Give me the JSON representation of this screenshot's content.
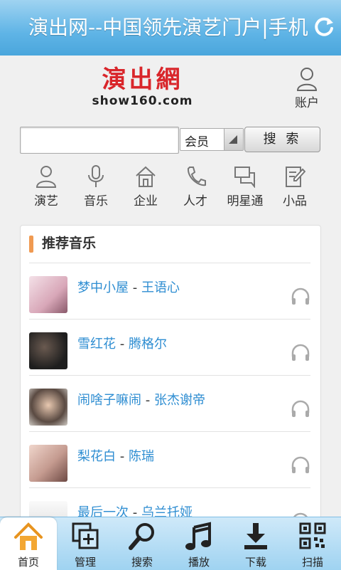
{
  "titlebar": {
    "title": "演出网--中国领先演艺门户|手机",
    "refresh_icon": "refresh-icon"
  },
  "logo": {
    "cn": "演出網",
    "en": "show160.com"
  },
  "account": {
    "label": "账户",
    "icon": "user-icon"
  },
  "search": {
    "value": "",
    "select_value": "会员",
    "button_label": "搜 索"
  },
  "categories": [
    {
      "label": "演艺",
      "icon": "user-icon"
    },
    {
      "label": "音乐",
      "icon": "microphone-icon"
    },
    {
      "label": "企业",
      "icon": "home-icon"
    },
    {
      "label": "人才",
      "icon": "phone-icon"
    },
    {
      "label": "明星通",
      "icon": "chat-icon"
    },
    {
      "label": "小品",
      "icon": "edit-icon"
    }
  ],
  "recommended": {
    "heading": "推荐音乐",
    "items": [
      {
        "title": "梦中小屋",
        "sep": " - ",
        "artist": "王语心",
        "thumb_color": "#d8a7b8"
      },
      {
        "title": "雪红花",
        "sep": " - ",
        "artist": "腾格尔",
        "thumb_color": "#2b2b2b"
      },
      {
        "title": "闹啥子嘛闹",
        "sep": " - ",
        "artist": "张杰谢帝",
        "thumb_color": "#b9b2aa"
      },
      {
        "title": "梨花白",
        "sep": " - ",
        "artist": "陈瑞",
        "thumb_color": "#c49a8f"
      },
      {
        "title": "最后一次",
        "sep": " - ",
        "artist": "乌兰托娅",
        "thumb_color": "#e6e6e6"
      }
    ]
  },
  "nav": [
    {
      "label": "首页",
      "icon": "home-icon",
      "active": true
    },
    {
      "label": "管理",
      "icon": "add-window-icon",
      "active": false
    },
    {
      "label": "搜索",
      "icon": "search-icon",
      "active": false
    },
    {
      "label": "播放",
      "icon": "music-note-icon",
      "active": false
    },
    {
      "label": "下载",
      "icon": "download-icon",
      "active": false
    },
    {
      "label": "扫描",
      "icon": "qrcode-icon",
      "active": false
    }
  ],
  "colors": {
    "accent": "#4aa6dc",
    "link": "#2f8ed2",
    "logo_red": "#d9262b",
    "heading_bar": "#f09a51"
  }
}
